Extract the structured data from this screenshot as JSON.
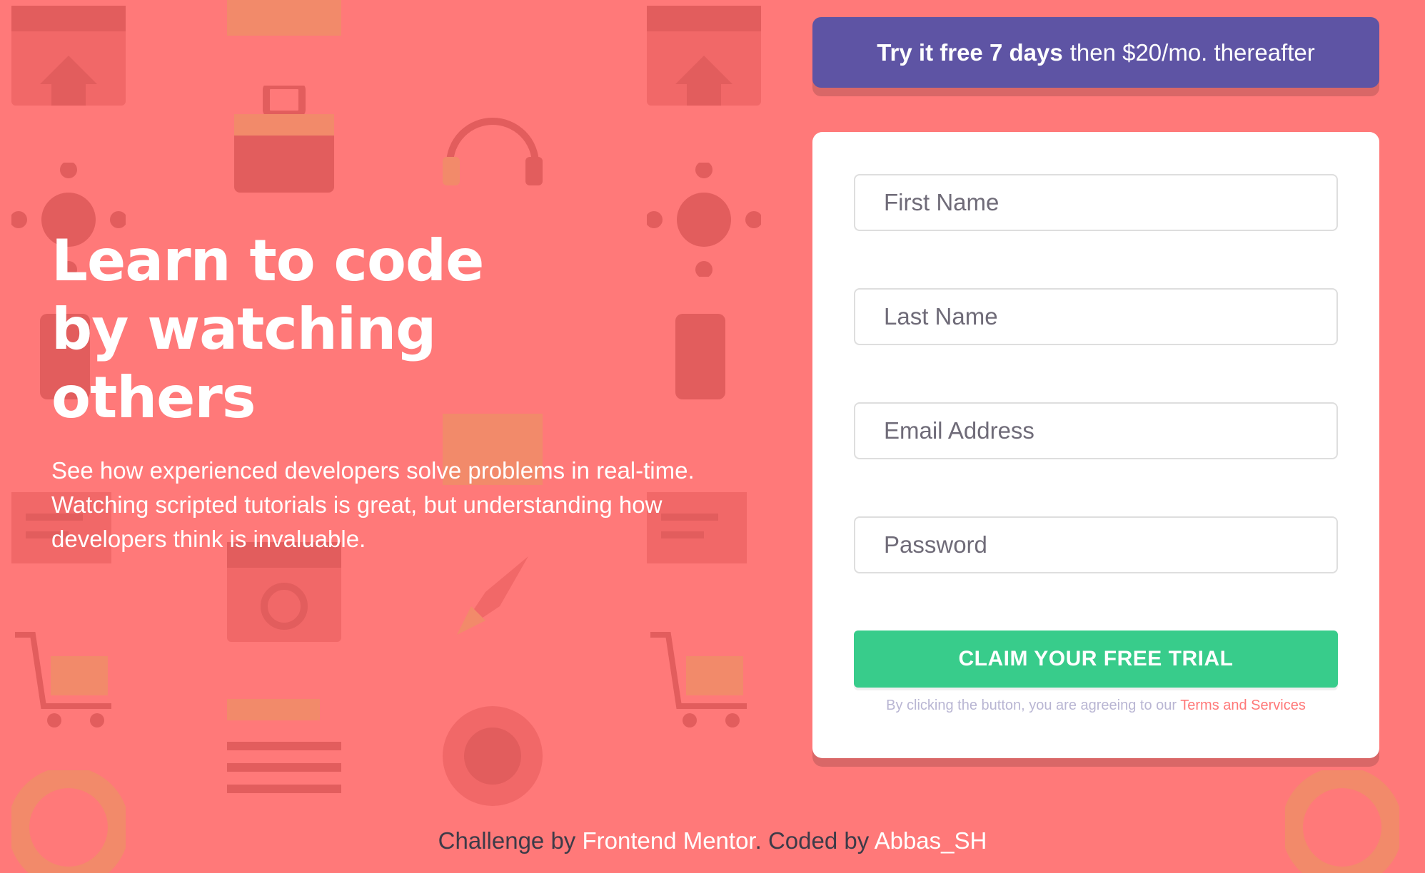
{
  "hero": {
    "title": "Learn to code by watching others",
    "description": "See how experienced developers solve problems in real-time. Watching scripted tutorials is great, but understanding how developers think is invaluable."
  },
  "promo": {
    "strong": "Try it free 7 days",
    "rest": "then $20/mo. thereafter"
  },
  "form": {
    "first_name_placeholder": "First Name",
    "last_name_placeholder": "Last Name",
    "email_placeholder": "Email Address",
    "password_placeholder": "Password",
    "submit_label": "CLAIM YOUR FREE TRIAL",
    "terms_prefix": "By clicking the button, you are agreeing to our",
    "terms_link": "Terms and Services"
  },
  "footer": {
    "challenge_by": "Challenge by",
    "challenge_link": "Frontend Mentor",
    "coded_by": ". Coded by",
    "coder_link": "Abbas_SH"
  },
  "colors": {
    "background": "#ff7979",
    "accent_purple": "#5e54a4",
    "cta_green": "#38cc8b",
    "link_red": "#ff7979"
  },
  "icons": {
    "background_pattern": [
      "browser-window-icon",
      "toolbox-icon",
      "network-hub-icon",
      "phone-icon",
      "rocket-icon",
      "shopping-cart-icon",
      "key-icon",
      "gear-globe-icon",
      "life-ring-icon",
      "headset-icon",
      "edit-document-icon"
    ]
  }
}
